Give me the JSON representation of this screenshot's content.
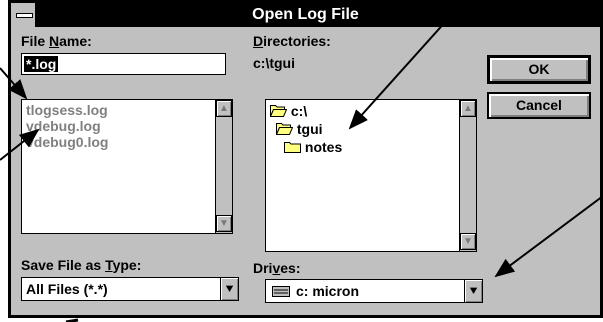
{
  "window": {
    "title": "Open Log File"
  },
  "file_name": {
    "label_prefix": "File ",
    "label_accel": "N",
    "label_suffix": "ame:",
    "value": "*.log",
    "files": [
      "tlogsess.log",
      "vdebug.log",
      "vdebug0.log"
    ]
  },
  "directories": {
    "label_accel": "D",
    "label_suffix": "irectories:",
    "current": "c:\\tgui",
    "items": [
      {
        "name": "c:\\",
        "icon": "open-folder-icon"
      },
      {
        "name": "tgui",
        "icon": "open-folder-icon"
      },
      {
        "name": "notes",
        "icon": "folder-icon"
      }
    ]
  },
  "file_type": {
    "label_prefix": "Save File as ",
    "label_accel": "T",
    "label_suffix": "ype:",
    "value": "All Files (*.*)"
  },
  "drives": {
    "label_prefix": "Dri",
    "label_accel": "v",
    "label_suffix": "es:",
    "value": "c: micron",
    "icon": "drive-icon"
  },
  "buttons": {
    "ok": "OK",
    "cancel": "Cancel"
  },
  "scroll_icons": {
    "up": "▲",
    "down": "▼",
    "dropdown": "⯆"
  },
  "colors": {
    "title_bar": "#000000",
    "dialog_face": "#c0c0c0",
    "folder": "#ffff80",
    "arrow": "#000000"
  }
}
